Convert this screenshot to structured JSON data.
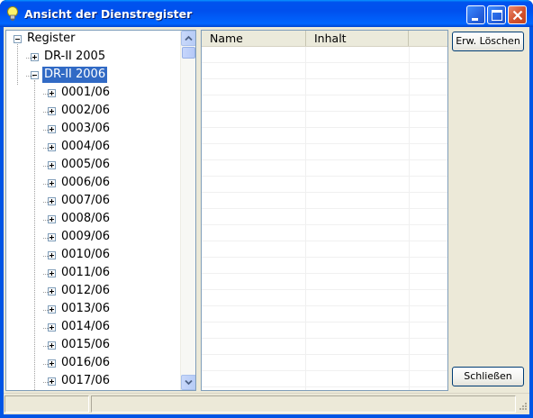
{
  "window": {
    "title": "Ansicht der Dienstregister"
  },
  "tree": {
    "root": "Register",
    "years": [
      {
        "label": "DR-II 2005",
        "expanded": false,
        "selected": false
      },
      {
        "label": "DR-II 2006",
        "expanded": true,
        "selected": true
      }
    ],
    "entries": [
      "0001/06",
      "0002/06",
      "0003/06",
      "0004/06",
      "0005/06",
      "0006/06",
      "0007/06",
      "0008/06",
      "0009/06",
      "0010/06",
      "0011/06",
      "0012/06",
      "0013/06",
      "0014/06",
      "0015/06",
      "0016/06",
      "0017/06"
    ]
  },
  "list": {
    "columns": [
      "Name",
      "Inhalt"
    ]
  },
  "buttons": {
    "erw_loeschen": "Erw. Löschen",
    "schliessen": "Schließen"
  },
  "colors": {
    "selection": "#316ac5",
    "titlebar": "#0054e3",
    "face": "#ece9d8"
  }
}
